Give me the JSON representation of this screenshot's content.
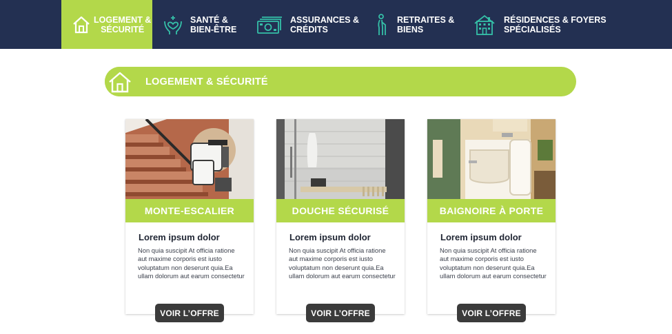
{
  "nav": {
    "items": [
      {
        "label_line1": "LOGEMENT &",
        "label_line2": "SÉCURITÉ",
        "icon": "house-icon",
        "active": true
      },
      {
        "label_line1": "SANTÉ &",
        "label_line2": "BIEN-ÊTRE",
        "icon": "heart-hands-icon",
        "active": false
      },
      {
        "label_line1": "ASSURANCES &",
        "label_line2": "CRÉDITS",
        "icon": "banknote-icon",
        "active": false
      },
      {
        "label_line1": "RETRAITES &",
        "label_line2": "BIENS",
        "icon": "elderly-cane-icon",
        "active": false
      },
      {
        "label_line1": "RÉSIDENCES & FOYERS",
        "label_line2": "SPÉCIALISÉS",
        "icon": "building-icon",
        "active": false
      }
    ]
  },
  "section": {
    "title": "LOGEMENT & SÉCURITÉ",
    "icon": "house-icon"
  },
  "cards": [
    {
      "title": "MONTE-ESCALIER",
      "heading": "Lorem ipsum dolor",
      "description": "Non quia suscipit At officia ratione aut maxime corporis est iusto voluptatum non deserunt quia.Ea ullam dolorum aut earum consectetur",
      "button": "VOIR L’OFFRE",
      "image": "stairlift-photo"
    },
    {
      "title": "DOUCHE SÉCURISÉ",
      "heading": "Lorem ipsum dolor",
      "description": "Non quia suscipit At officia ratione aut maxime corporis est iusto voluptatum non deserunt quia.Ea ullam dolorum aut earum consectetur",
      "button": "VOIR L’OFFRE",
      "image": "walk-in-shower-photo"
    },
    {
      "title": "BAIGNOIRE À PORTE",
      "heading": "Lorem ipsum dolor",
      "description": "Non quia suscipit At officia ratione aut maxime corporis est iusto voluptatum non deserunt quia.Ea ullam dolorum aut earum consectetur",
      "button": "VOIR L’OFFRE",
      "image": "walk-in-bathtub-photo"
    }
  ],
  "colors": {
    "nav_bg": "#233052",
    "accent": "#b3d84a",
    "icon_teal": "#35c0a8",
    "button_bg": "#3b3b3b"
  }
}
